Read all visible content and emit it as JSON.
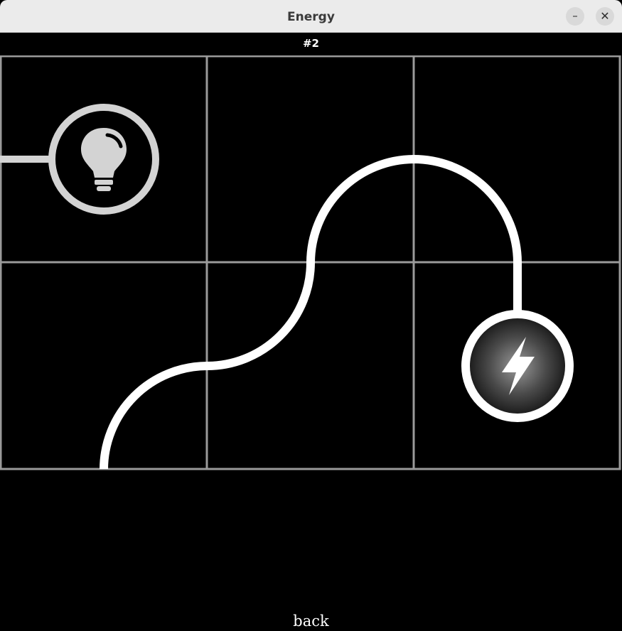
{
  "window": {
    "title": "Energy",
    "minimize_glyph": "–",
    "close_glyph": "✕"
  },
  "level": {
    "label": "#2"
  },
  "board": {
    "rows": 2,
    "cols": 3,
    "tiles": [
      {
        "row": 0,
        "col": 0,
        "content": "bulb",
        "icon": "lightbulb-icon"
      },
      {
        "row": 0,
        "col": 1,
        "content": "curved-wire"
      },
      {
        "row": 0,
        "col": 2,
        "content": "curved-wire"
      },
      {
        "row": 1,
        "col": 0,
        "content": "curved-wire"
      },
      {
        "row": 1,
        "col": 1,
        "content": "curved-wire"
      },
      {
        "row": 1,
        "col": 2,
        "content": "power-source",
        "icon": "lightning-bolt-icon"
      }
    ],
    "colors": {
      "background": "#000000",
      "grid": "#9a9a9a",
      "wire_powered": "#ffffff",
      "bulb_unlit": "#d3d3d3"
    }
  },
  "footer": {
    "back_label": "back"
  }
}
